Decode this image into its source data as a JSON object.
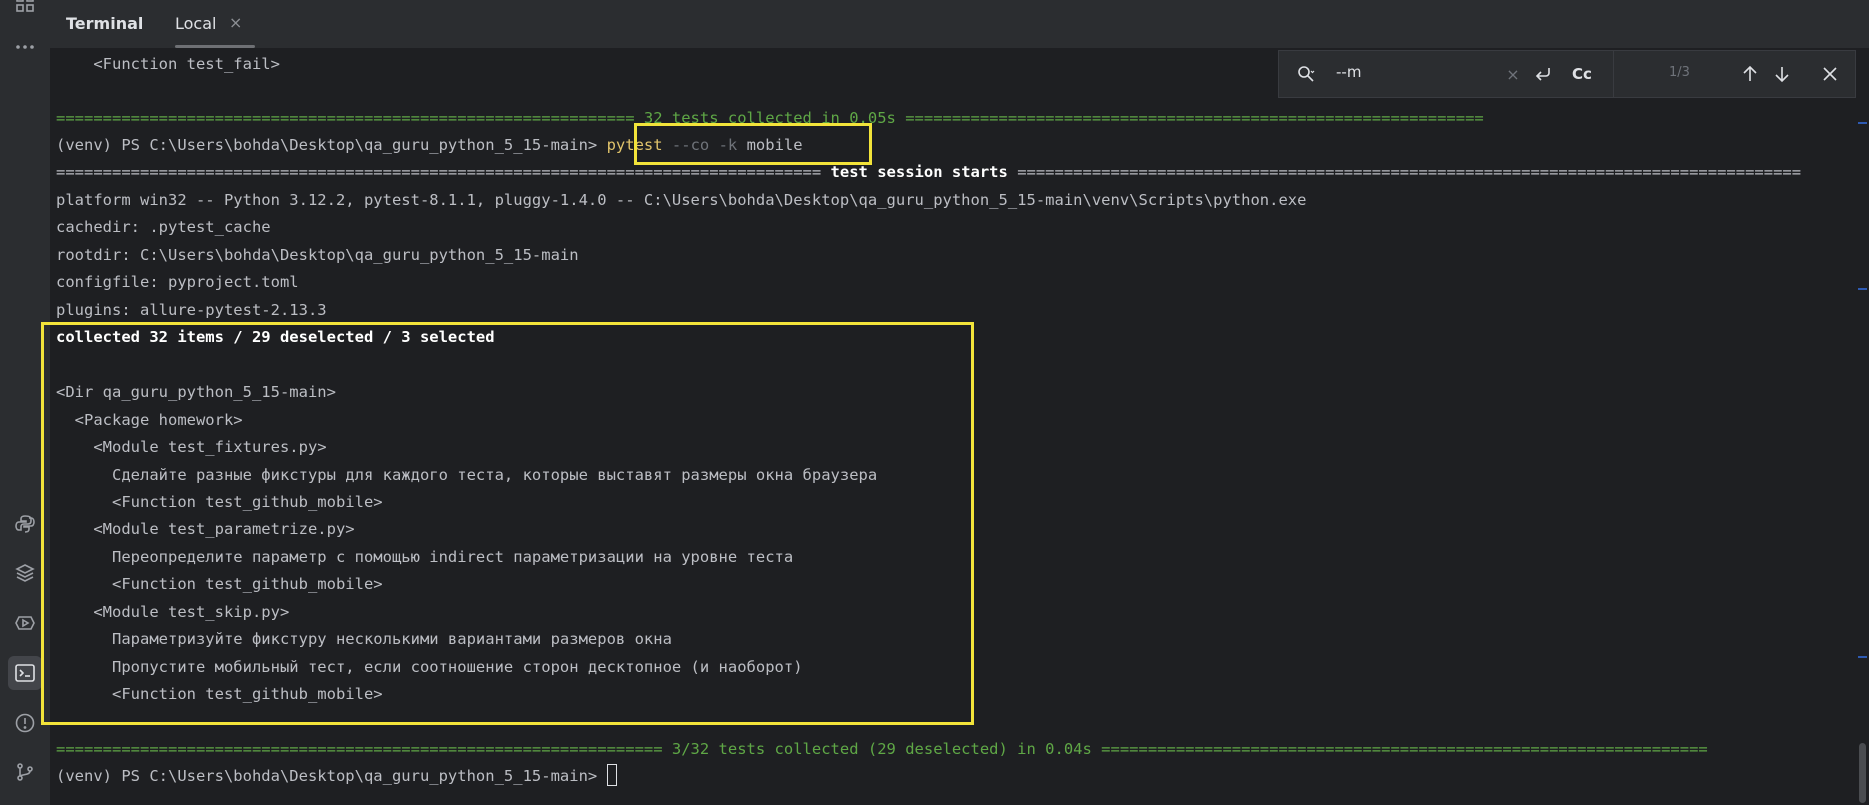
{
  "tabbar": {
    "title": "Terminal",
    "tab_label": "Local",
    "tab_close": "×"
  },
  "search": {
    "query": "--m",
    "clear": "×",
    "case_label": "Cc",
    "count": "1/3"
  },
  "terminal": {
    "prev_function": "    <Function test_fail>",
    "sep_collected_1": "============================================================== 32 tests collected in 0.05s ==============================================================",
    "prompt_1": "(venv) PS C:\\Users\\bohda\\Desktop\\qa_guru_python_5_15-main> ",
    "cmd_pytest": "pytest",
    "cmd_co": " --co",
    "cmd_k": " -k",
    "cmd_mobile": " mobile",
    "sep_session_left": "================================================================================== ",
    "sep_session_title": "test session starts",
    "sep_session_right": " ====================================================================================",
    "platform": "platform win32 -- Python 3.12.2, pytest-8.1.1, pluggy-1.4.0 -- C:\\Users\\bohda\\Desktop\\qa_guru_python_5_15-main\\venv\\Scripts\\python.exe",
    "cachedir": "cachedir: .pytest_cache",
    "rootdir": "rootdir: C:\\Users\\bohda\\Desktop\\qa_guru_python_5_15-main",
    "configfile": "configfile: pyproject.toml",
    "plugins": "plugins: allure-pytest-2.13.3",
    "collected": "collected 32 items / 29 deselected / 3 selected",
    "dir": "<Dir qa_guru_python_5_15-main>",
    "package": "  <Package homework>",
    "module_fixtures": "    <Module test_fixtures.py>",
    "fixtures_desc": "      Сделайте разные фикстуры для каждого теста, которые выставят размеры окна браузера",
    "function_1": "      <Function test_github_mobile>",
    "module_parametrize": "    <Module test_parametrize.py>",
    "parametrize_desc": "      Переопределите параметр с помощью indirect параметризации на уровне теста",
    "function_2": "      <Function test_github_mobile>",
    "module_skip": "    <Module test_skip.py>",
    "skip_desc_1": "      Параметризуйте фикстуру несколькими вариантами размеров окна",
    "skip_desc_2": "      Пропустите мобильный тест, если соотношение сторон десктопное (и наоборот)",
    "function_3": "      <Function test_github_mobile>",
    "sep_collected_2": "================================================================= 3/32 tests collected (29 deselected) in 0.04s =================================================================",
    "prompt_2": "(venv) PS C:\\Users\\bohda\\Desktop\\qa_guru_python_5_15-main> "
  },
  "colors": {
    "background": "#1e1f22",
    "text": "#bcbec4",
    "separator_green": "#5fa746",
    "command_yellow": "#e0c36b",
    "highlight_box": "#f2e33a"
  },
  "icons": {
    "strip": [
      "grid-icon",
      "more-icon",
      "python-icon",
      "layers-icon",
      "run-icon",
      "terminal-icon",
      "problems-icon",
      "git-icon"
    ],
    "search": [
      "search-icon",
      "clear-icon",
      "regex-newline-icon",
      "match-case-icon",
      "arrow-up-icon",
      "arrow-down-icon",
      "close-icon"
    ]
  }
}
